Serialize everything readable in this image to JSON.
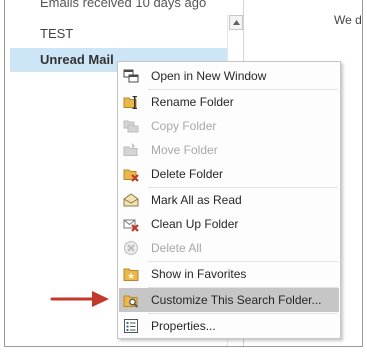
{
  "folder_pane": {
    "items": [
      {
        "label": "Emails received 10 days ago"
      },
      {
        "label": "TEST"
      },
      {
        "label": "Unread Mail"
      }
    ]
  },
  "reading_pane": {
    "text": "We d"
  },
  "context_menu": {
    "items": [
      {
        "label": "Open in New Window",
        "icon": "open-window-icon",
        "enabled": true
      },
      {
        "label": "Rename Folder",
        "icon": "rename-folder-icon",
        "enabled": true
      },
      {
        "label": "Copy Folder",
        "icon": "copy-folder-icon",
        "enabled": false
      },
      {
        "label": "Move Folder",
        "icon": "move-folder-icon",
        "enabled": false
      },
      {
        "label": "Delete Folder",
        "icon": "delete-folder-icon",
        "enabled": true
      },
      {
        "label": "Mark All as Read",
        "icon": "mark-read-icon",
        "enabled": true
      },
      {
        "label": "Clean Up Folder",
        "icon": "clean-up-icon",
        "enabled": true
      },
      {
        "label": "Delete All",
        "icon": "delete-all-icon",
        "enabled": false
      },
      {
        "label": "Show in Favorites",
        "icon": "favorites-icon",
        "enabled": true
      },
      {
        "label": "Customize This Search Folder...",
        "icon": "customize-search-folder-icon",
        "enabled": true,
        "highlighted": true
      },
      {
        "label": "Properties...",
        "icon": "properties-icon",
        "enabled": true
      }
    ]
  },
  "annotation": {
    "icon": "pointer-arrow-icon",
    "color": "#c0392b"
  },
  "colors": {
    "selected_row": "#cde6f7",
    "menu_highlight": "#c6c6c6",
    "folder_yellow": "#e8b84b",
    "delete_red": "#c0392b"
  }
}
